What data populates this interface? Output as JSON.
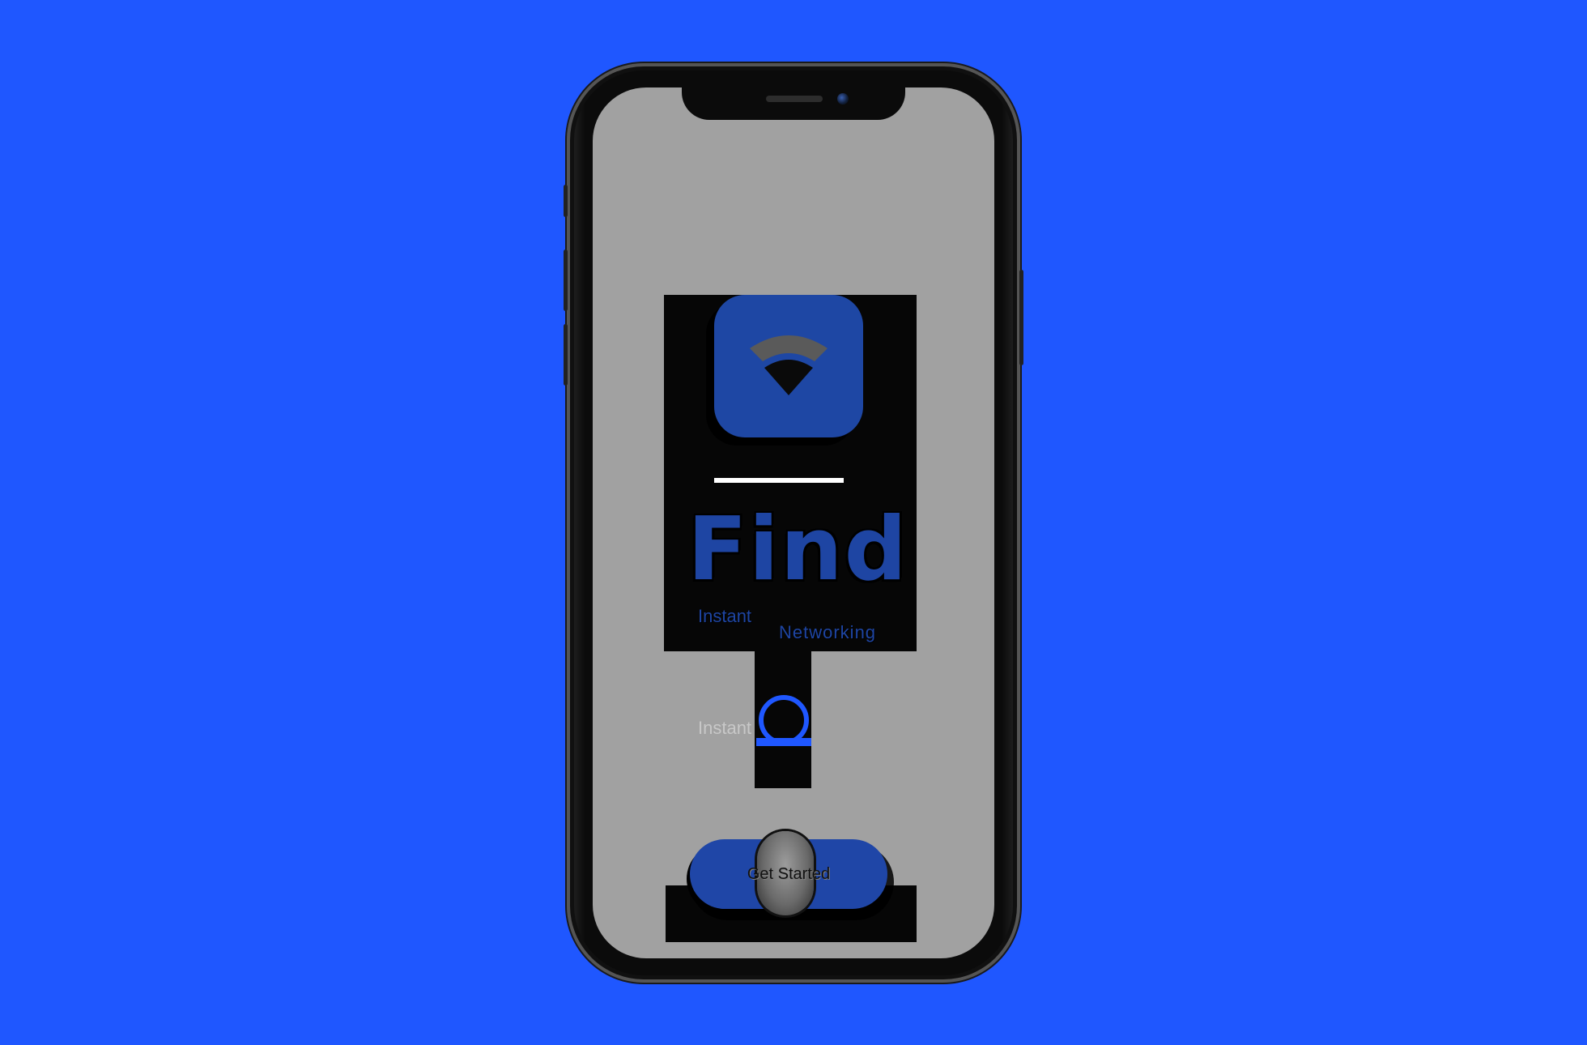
{
  "app": {
    "title": "Find",
    "tagline_line1": "Instant",
    "tagline_line2": "Networking",
    "ghost_text": "Instant"
  },
  "cta": {
    "label": "Get Started"
  },
  "icons": {
    "app_icon": "wifi-signal-icon",
    "secondary": "ring-icon"
  },
  "colors": {
    "background": "#1f57ff",
    "brand_blue": "#1e45a3",
    "screen_gray": "#a1a1a1"
  }
}
